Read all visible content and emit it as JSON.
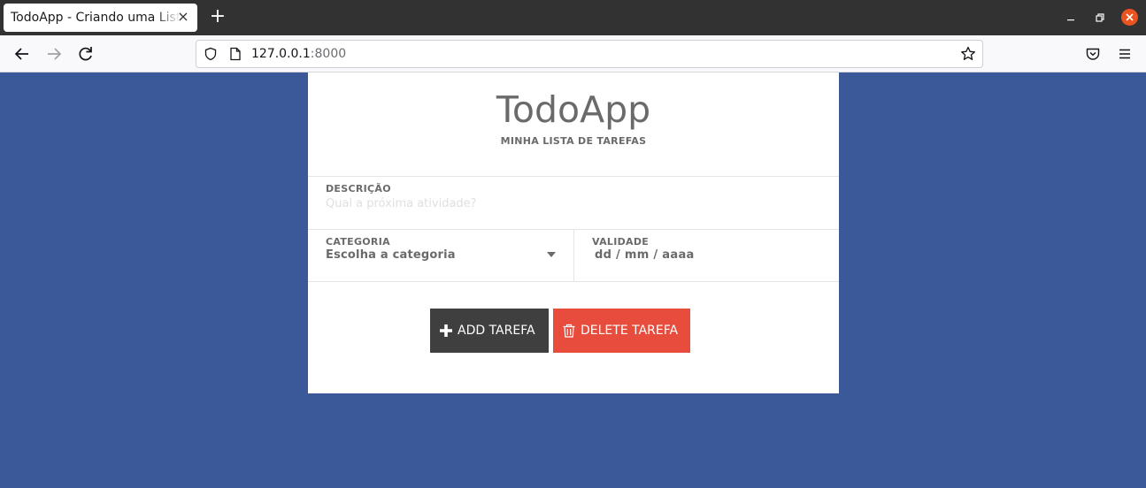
{
  "browser": {
    "tab_title": "TodoApp - Criando uma Lista de Tarefas",
    "tab_close": "×",
    "new_tab": "+",
    "url_host": "127.0.0.1",
    "url_port": ":8000"
  },
  "app": {
    "title": "TodoApp",
    "subtitle": "MINHA LISTA DE TAREFAS"
  },
  "form": {
    "description_label": "DESCRIÇÃO",
    "description_placeholder": "Qual a próxima atividade?",
    "description_value": "",
    "category_label": "CATEGORIA",
    "category_selected": "Escolha a categoria",
    "validity_label": "VALIDADE",
    "validity_value": "dd / mm / aaaa"
  },
  "buttons": {
    "add_label": "ADD TAREFA",
    "delete_label": "DELETE TAREFA"
  },
  "colors": {
    "background": "#3b5998",
    "add_button": "#3f3f3f",
    "delete_button": "#e74c3c",
    "close_window": "#e95420"
  }
}
